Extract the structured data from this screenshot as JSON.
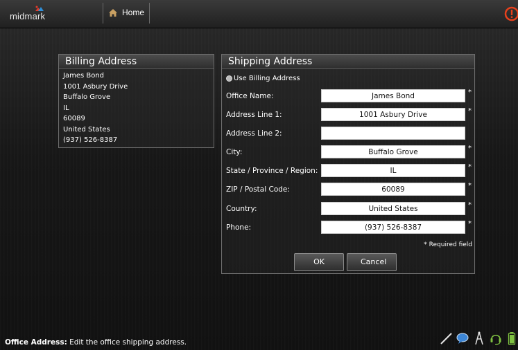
{
  "topbar": {
    "logo_text": "midmark",
    "home_label": "Home",
    "icons": [
      "house-icon",
      "alert-icon"
    ]
  },
  "billing": {
    "title": "Billing Address",
    "lines": [
      "James Bond",
      "1001 Asbury Drive",
      "Buffalo Grove",
      "IL",
      "60089",
      "United States",
      "(937) 526-8387"
    ]
  },
  "shipping": {
    "title": "Shipping Address",
    "use_billing_label": "Use Billing Address",
    "fields": [
      {
        "label": "Office Name:",
        "value": "James Bond",
        "required": "*"
      },
      {
        "label": "Address Line 1:",
        "value": "1001 Asbury Drive",
        "required": "*"
      },
      {
        "label": "Address Line 2:",
        "value": "",
        "required": ""
      },
      {
        "label": "City:",
        "value": "Buffalo Grove",
        "required": "*"
      },
      {
        "label": "State / Province / Region:",
        "value": "IL",
        "required": "*"
      },
      {
        "label": "ZIP / Postal Code:",
        "value": "60089",
        "required": "*"
      },
      {
        "label": "Country:",
        "value": "United States",
        "required": "*"
      },
      {
        "label": "Phone:",
        "value": "(937) 526-8387",
        "required": "*"
      }
    ],
    "required_note": "* Required field",
    "ok_label": "OK",
    "cancel_label": "Cancel"
  },
  "status": {
    "title": "Office Address:",
    "text": " Edit the office shipping address."
  },
  "tray_icons": [
    "pen-icon",
    "chat-bubble-icon",
    "tower-icon",
    "headset-icon",
    "battery-icon"
  ],
  "colors": {
    "alert": "#e8411c",
    "battery": "#7fc241",
    "chat": "#3d86d6"
  }
}
